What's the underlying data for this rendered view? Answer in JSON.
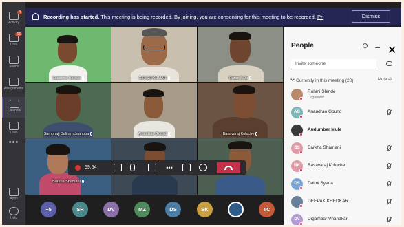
{
  "rail": {
    "items": [
      {
        "label": "Activity",
        "badge": "4"
      },
      {
        "label": "Chat",
        "badge": "16"
      },
      {
        "label": "Teams",
        "badge": ""
      },
      {
        "label": "Assignments",
        "badge": ""
      },
      {
        "label": "Calendar",
        "badge": ""
      },
      {
        "label": "Calls",
        "badge": ""
      }
    ],
    "bottom": [
      {
        "label": "Apps"
      },
      {
        "label": "Help"
      }
    ]
  },
  "banner": {
    "bold": "Recording has started.",
    "text": " This meeting is being recorded. By joining, you are consenting for this meeting to be recorded. ",
    "privacy": "Pri",
    "dismiss": "Dismiss"
  },
  "tiles": [
    {
      "name": "Sadashiv Bebale",
      "bg": "#6fb86f"
    },
    {
      "name": "GIRISH KUMAR",
      "bg": "#c9bfae"
    },
    {
      "name": "Ratan B Ja",
      "bg": "#8c8f86"
    },
    {
      "name": "Sambhaji Baliram Jaanoba",
      "bg": "#4d6a52"
    },
    {
      "name": "Anandrao Gound",
      "bg": "#a79c8a"
    },
    {
      "name": "Basavaraj Koluche",
      "bg": "#6c5444"
    },
    {
      "name": "Barkha Shamani",
      "bg": "#3a5e80"
    },
    {
      "name": "",
      "bg": "#3d4a56"
    },
    {
      "name": "",
      "bg": "#4c5f50"
    }
  ],
  "controls": {
    "timer": "59:54"
  },
  "strip": [
    {
      "initials": "+5",
      "color": "#5d5eaa"
    },
    {
      "initials": "SR",
      "color": "#4a8a8c"
    },
    {
      "initials": "DV",
      "color": "#8a6fa8"
    },
    {
      "initials": "MZ",
      "color": "#4f8a5a"
    },
    {
      "initials": "DS",
      "color": "#4d7fa6"
    },
    {
      "initials": "SK",
      "color": "#c9a040"
    },
    {
      "initials": "",
      "color": "#2f5d8a"
    },
    {
      "initials": "TC",
      "color": "#c55a3a"
    }
  ],
  "panel": {
    "title": "People",
    "invite_placeholder": "Invite someone",
    "section": "Currently in this meeting (20)",
    "mute_all": "Mute all",
    "people": [
      {
        "name": "Rohini Shinde",
        "role": "Organizer",
        "initials": "",
        "color": "#b98a6a",
        "bold": false
      },
      {
        "name": "Anandrao Gound",
        "role": "",
        "initials": "AG",
        "color": "#7fb6b6",
        "bold": false
      },
      {
        "name": "Audumber Mule",
        "role": "",
        "initials": "",
        "color": "#3a3a3a",
        "bold": true
      },
      {
        "name": "Barkha Shamani",
        "role": "",
        "initials": "BS",
        "color": "#e39aa8",
        "bold": false
      },
      {
        "name": "Basavaraj Koluche",
        "role": "",
        "initials": "BK",
        "color": "#e39aa8",
        "bold": false
      },
      {
        "name": "Daimi Syeda",
        "role": "",
        "initials": "DS",
        "color": "#7aa6d6",
        "bold": false
      },
      {
        "name": "DEEPAK KHEDKAR",
        "role": "",
        "initials": "",
        "color": "#6a7f9a",
        "bold": false
      },
      {
        "name": "Digambar Vhandkar",
        "role": "",
        "initials": "DV",
        "color": "#b49ad6",
        "bold": false
      }
    ]
  }
}
